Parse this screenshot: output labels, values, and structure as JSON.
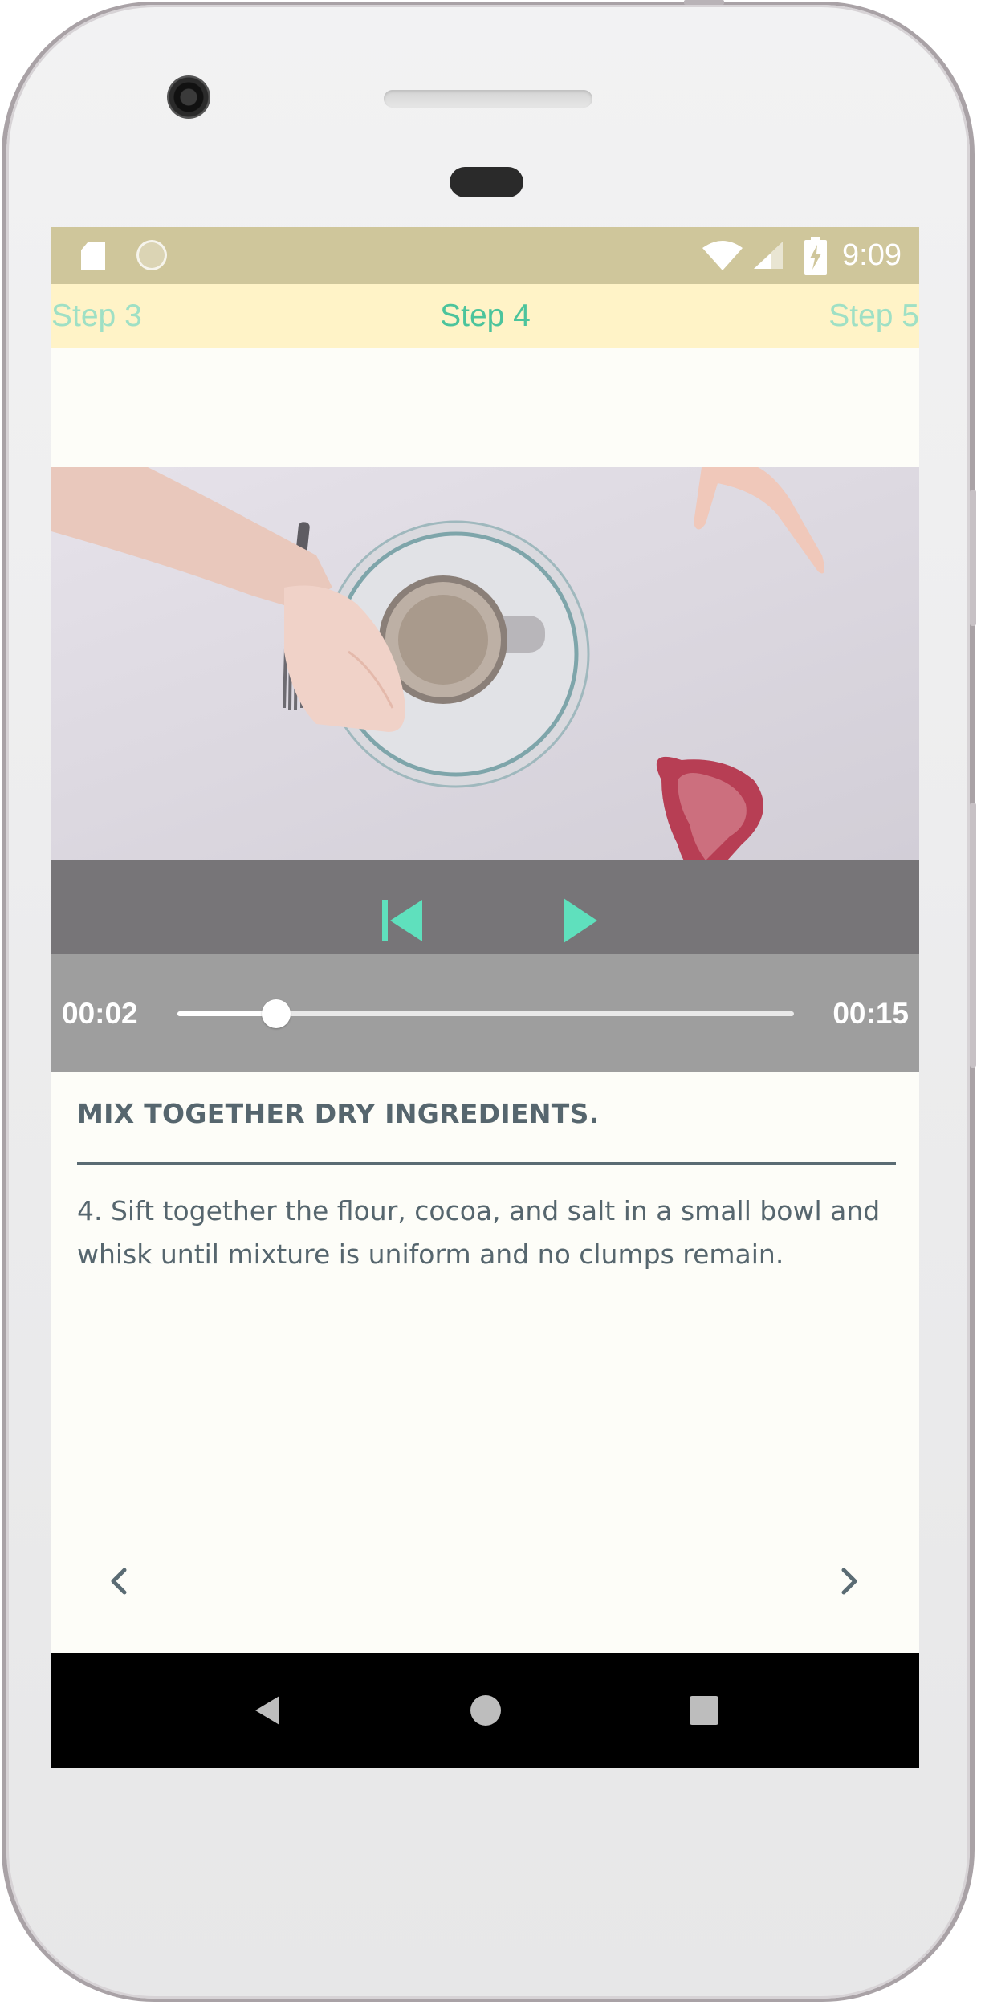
{
  "status_bar": {
    "time": "9:09",
    "icons": [
      "sd-card-icon",
      "sync-icon",
      "wifi-icon",
      "signal-icon",
      "battery-charging-icon"
    ],
    "background": "#cfc69b"
  },
  "step_tabs": {
    "previous": "Step 3",
    "current": "Step 4",
    "next": "Step 5",
    "accent": "#4cc49c"
  },
  "player": {
    "current_time": "00:02",
    "duration": "00:15",
    "progress_fraction": 0.16,
    "controls": [
      "skip-previous-icon",
      "play-icon"
    ],
    "accent": "#5fe0bd"
  },
  "step": {
    "title": "MIX TOGETHER DRY INGREDIENTS.",
    "description": "4. Sift together the flour, cocoa, and salt in a small bowl and whisk until mixture is uniform and no clumps remain."
  },
  "navigation": {
    "icons": [
      "chevron-left-icon",
      "chevron-right-icon"
    ]
  },
  "system_nav": {
    "icons": [
      "back-icon",
      "home-icon",
      "recents-icon"
    ]
  }
}
